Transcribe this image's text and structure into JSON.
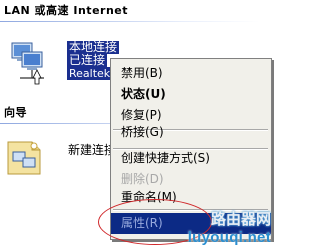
{
  "sections": {
    "lan_header": "LAN 或高速 Internet",
    "wizard_header": "向导"
  },
  "connection": {
    "line1": "本地连接",
    "line2": "已连接",
    "line3": "Realtek",
    "icon": "network-connection-icon"
  },
  "wizard": {
    "label": "新建连接",
    "icon": "new-connection-wizard-icon"
  },
  "context_menu": {
    "disable": "禁用(B)",
    "status": "状态(U)",
    "repair": "修复(P)",
    "bridge": "桥接(G)",
    "create_shortcut": "创建快捷方式(S)",
    "delete": "删除(D)",
    "rename": "重命名(M)",
    "properties": "属性(R)"
  },
  "watermark": {
    "top": "路由器网",
    "bottom": "luyouqi.net"
  },
  "colors": {
    "selection": "#1a2f8f",
    "menu_highlight": "#0c2a85",
    "annotation": "#d0282b"
  }
}
